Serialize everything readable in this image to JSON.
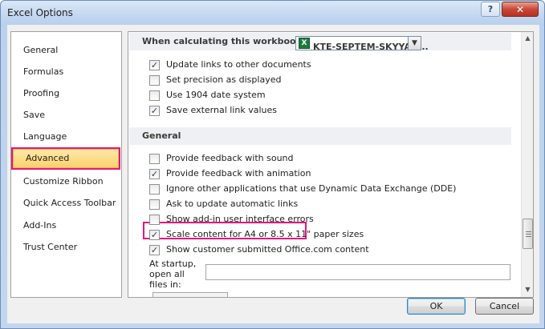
{
  "window": {
    "title": "Excel Options"
  },
  "title_buttons": {
    "help": "?",
    "close": "✕"
  },
  "nav": {
    "items": [
      {
        "label": "General",
        "selected": false
      },
      {
        "label": "Formulas",
        "selected": false
      },
      {
        "label": "Proofing",
        "selected": false
      },
      {
        "label": "Save",
        "selected": false
      },
      {
        "label": "Language",
        "selected": false
      },
      {
        "label": "Advanced",
        "selected": true
      },
      {
        "label": "Customize Ribbon",
        "selected": false
      },
      {
        "label": "Quick Access Toolbar",
        "selected": false
      },
      {
        "label": "Add-Ins",
        "selected": false
      },
      {
        "label": "Trust Center",
        "selected": false
      }
    ]
  },
  "content": {
    "calc_section": {
      "label": "When calculating this workbook:",
      "workbook_select": "KTE-SEPTEM-SKYYAN..."
    },
    "calc_options": [
      {
        "label": "Update links to other documents",
        "checked": true
      },
      {
        "label": "Set precision as displayed",
        "checked": false
      },
      {
        "label": "Use 1904 date system",
        "checked": false
      },
      {
        "label": "Save external link values",
        "checked": true
      }
    ],
    "general_section": {
      "label": "General"
    },
    "general_options": [
      {
        "label": "Provide feedback with sound",
        "checked": false
      },
      {
        "label": "Provide feedback with animation",
        "checked": true
      },
      {
        "label": "Ignore other applications that use Dynamic Data Exchange (DDE)",
        "checked": false
      },
      {
        "label": "Ask to update automatic links",
        "checked": false
      },
      {
        "label": "Show add-in user interface errors",
        "checked": false
      },
      {
        "label": "Scale content for A4 or 8.5 x 11\" paper sizes",
        "checked": true
      },
      {
        "label": "Show customer submitted Office.com content",
        "checked": true
      }
    ],
    "startup": {
      "label": "At startup, open all files in:",
      "value": ""
    }
  },
  "icons": {
    "excel": "X",
    "check": "✓",
    "dropdown": "▼",
    "scroll_up": "▲",
    "scroll_down": "▼"
  },
  "colors": {
    "highlight": "#e5177e",
    "selected_bg": "#fcd26f"
  },
  "buttons": {
    "ok": "OK",
    "cancel": "Cancel"
  }
}
